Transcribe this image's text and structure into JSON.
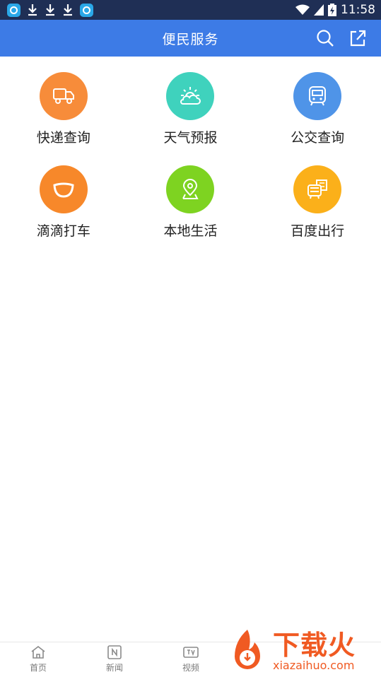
{
  "status_bar": {
    "time": "11:58"
  },
  "header": {
    "title": "便民服务"
  },
  "services": [
    {
      "label": "快递查询",
      "color": "#f78c3a",
      "icon": "delivery-truck-icon"
    },
    {
      "label": "天气预报",
      "color": "#3fd2bd",
      "icon": "weather-sun-cloud-icon"
    },
    {
      "label": "公交查询",
      "color": "#4f94e8",
      "icon": "bus-icon"
    },
    {
      "label": "滴滴打车",
      "color": "#f7882a",
      "icon": "didi-icon"
    },
    {
      "label": "本地生活",
      "color": "#7ed321",
      "icon": "location-pin-icon"
    },
    {
      "label": "百度出行",
      "color": "#fbb01a",
      "icon": "bus-ticket-icon"
    }
  ],
  "tabs": [
    {
      "label": "首页",
      "icon": "home-icon"
    },
    {
      "label": "新闻",
      "icon": "news-icon"
    },
    {
      "label": "视频",
      "icon": "tv-icon"
    }
  ],
  "watermark": {
    "brand_cn": "下载火",
    "brand_en": "xiazaihuo.com"
  }
}
